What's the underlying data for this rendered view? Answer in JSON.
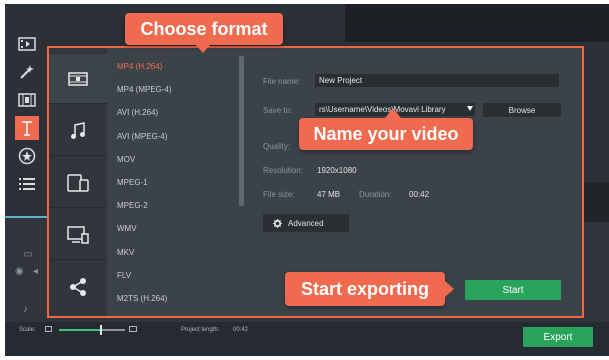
{
  "toolbar": {
    "tools": [
      {
        "icon": "video-import-icon"
      },
      {
        "icon": "magic-wand-icon"
      },
      {
        "icon": "filmstrip-icon"
      },
      {
        "icon": "text-titles-icon",
        "active": true
      },
      {
        "icon": "stickers-icon"
      },
      {
        "icon": "menu-list-icon"
      }
    ]
  },
  "dialog": {
    "categories": [
      {
        "icon": "video-format-icon",
        "active": true
      },
      {
        "icon": "audio-note-icon"
      },
      {
        "icon": "devices-icon"
      },
      {
        "icon": "tv-icon"
      },
      {
        "icon": "share-icon"
      }
    ],
    "formats": [
      "MP4 (H.264)",
      "MP4 (MPEG-4)",
      "AVI (H.264)",
      "AVI (MPEG-4)",
      "MOV",
      "MPEG-1",
      "MPEG-2",
      "WMV",
      "MKV",
      "FLV",
      "M2TS (H.264)"
    ],
    "selected_format": "MP4 (H.264)",
    "file_name_label": "File name:",
    "file_name_value": "New Project",
    "save_to_label": "Save to:",
    "save_to_value": "rs\\Username\\Videos\\Movavi Library",
    "browse_label": "Browse",
    "quality_label": "Quality:",
    "resolution_label": "Resolution:",
    "resolution_value": "1920x1080",
    "file_size_label": "File size:",
    "file_size_value": "47 MB",
    "duration_label": "Duration:",
    "duration_value": "00:42",
    "advanced_label": "Advanced",
    "start_label": "Start"
  },
  "callouts": {
    "choose_format": "Choose format",
    "name_video": "Name your video",
    "start_exporting": "Start exporting"
  },
  "statusbar": {
    "scale_label": "Scale:",
    "scale_level": 0.62,
    "project_length_label": "Project length:",
    "project_length_value": "00:42",
    "export_label": "Export"
  },
  "colors": {
    "accent": "#ef6a4e",
    "start_green": "#27a35a",
    "selected_format": "#f06d4f"
  }
}
